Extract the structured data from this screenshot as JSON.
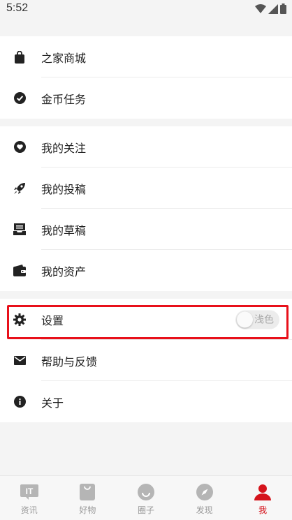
{
  "status": {
    "time": "5:52"
  },
  "sections": [
    {
      "items": [
        {
          "icon": "shopping-bag-icon",
          "label": "之家商城"
        },
        {
          "icon": "check-circle-icon",
          "label": "金币任务"
        }
      ]
    },
    {
      "items": [
        {
          "icon": "heart-circle-icon",
          "label": "我的关注"
        },
        {
          "icon": "rocket-icon",
          "label": "我的投稿"
        },
        {
          "icon": "inbox-tray-icon",
          "label": "我的草稿"
        },
        {
          "icon": "wallet-icon",
          "label": "我的资产"
        }
      ]
    },
    {
      "items": [
        {
          "icon": "gear-icon",
          "label": "设置",
          "toggle_label": "浅色"
        },
        {
          "icon": "mail-icon",
          "label": "帮助与反馈"
        },
        {
          "icon": "info-icon",
          "label": "关于"
        }
      ]
    }
  ],
  "tabs": [
    {
      "icon": "news-icon",
      "label": "资讯"
    },
    {
      "icon": "shop-bag-icon",
      "label": "好物"
    },
    {
      "icon": "smile-icon",
      "label": "圈子"
    },
    {
      "icon": "compass-icon",
      "label": "发现"
    },
    {
      "icon": "person-icon",
      "label": "我",
      "active": true
    }
  ],
  "colors": {
    "accent": "#d5141c",
    "highlight_box": "#e8101a",
    "icon": "#222222"
  }
}
